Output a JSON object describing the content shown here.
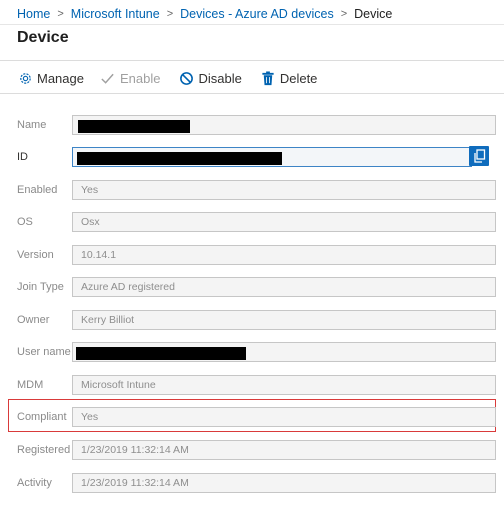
{
  "breadcrumb": {
    "items": [
      "Home",
      "Microsoft Intune",
      "Devices - Azure AD devices"
    ],
    "current": "Device"
  },
  "page": {
    "title": "Device"
  },
  "toolbar": {
    "manage": {
      "label": "Manage",
      "icon": "gear-icon"
    },
    "enable": {
      "label": "Enable",
      "icon": "checkmark-icon",
      "disabled": true
    },
    "disable": {
      "label": "Disable",
      "icon": "block-icon"
    },
    "delete": {
      "label": "Delete",
      "icon": "trash-icon"
    }
  },
  "fields": {
    "name": {
      "label": "Name",
      "value": "",
      "redacted": true
    },
    "id": {
      "label": "ID",
      "value": "",
      "redacted": true
    },
    "enabled": {
      "label": "Enabled",
      "value": "Yes"
    },
    "os": {
      "label": "OS",
      "value": "Osx"
    },
    "version": {
      "label": "Version",
      "value": "10.14.1"
    },
    "join_type": {
      "label": "Join Type",
      "value": "Azure AD registered"
    },
    "owner": {
      "label": "Owner",
      "value": "Kerry Billiot"
    },
    "user_name": {
      "label": "User name",
      "value": "",
      "redacted": true
    },
    "mdm": {
      "label": "MDM",
      "value": "Microsoft Intune"
    },
    "compliant": {
      "label": "Compliant",
      "value": "Yes",
      "highlighted": true
    },
    "registered": {
      "label": "Registered",
      "value": "1/23/2019 11:32:14 AM"
    },
    "activity": {
      "label": "Activity",
      "value": "1/23/2019 11:32:14 AM"
    }
  },
  "colors": {
    "link": "#0063b1",
    "accent": "#0f6cbd",
    "highlight_border": "#d93a3a",
    "disabled_text": "#a0a0a0"
  }
}
